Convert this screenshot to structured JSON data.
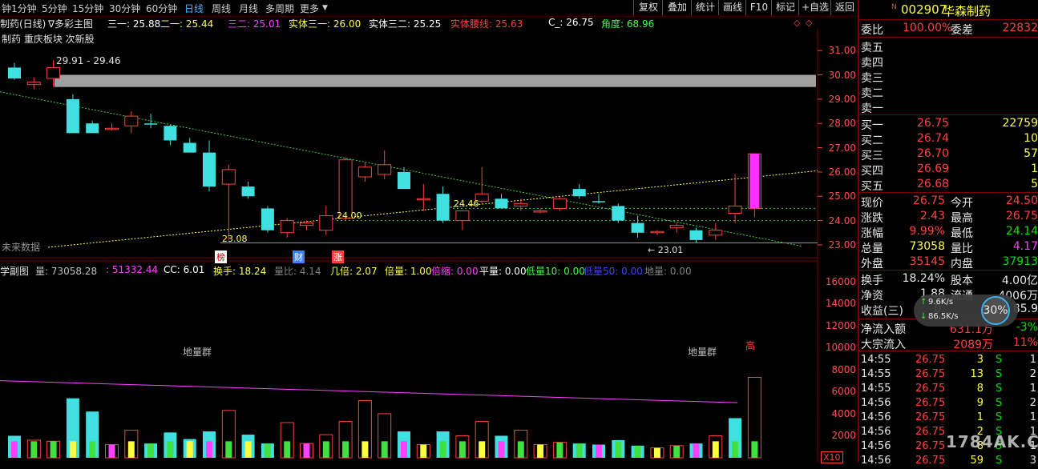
{
  "toolbar": {
    "periods": [
      "1分钟",
      "5分钟",
      "15分钟",
      "30分钟",
      "60分钟",
      "日线",
      "周线",
      "月线",
      "多周期",
      "更多"
    ],
    "active": "日线",
    "buttons": [
      "复权",
      "叠加",
      "统计",
      "画线",
      "F10",
      "标记",
      "+自选",
      "返回"
    ],
    "lead_label": "钟"
  },
  "main": {
    "title": "制药(日线)",
    "title_suffix": "∇多彩主图",
    "indicators": [
      {
        "label": "三一: 25.88",
        "color": "#ffffff"
      },
      {
        "label": "二一: 25.44",
        "color": "#ffff40"
      },
      {
        "label": "三二: 25.01",
        "color": "#ff40ff"
      },
      {
        "label": "实体三一: 26.00",
        "color": "#ffff40"
      },
      {
        "label": "实体三二: 25.25",
        "color": "#ffffff"
      },
      {
        "label": "实体腰线: 25.63",
        "color": "#ff4040"
      },
      {
        "label": "C_: 26.75",
        "color": "#ffffff"
      },
      {
        "label": "角度: 68.96",
        "color": "#40ff40"
      }
    ],
    "sector_label": "制药 重庆板块 次新股",
    "range_label": "29.91 - 29.46",
    "future_label": "未来数据",
    "price_ticks": [
      "31.00",
      "30.00",
      "29.00",
      "28.00",
      "27.00",
      "26.00",
      "25.00",
      "24.00",
      "23.00"
    ],
    "level_labels": {
      "low": "23.08",
      "mid1": "24.00",
      "mid2": "24.46",
      "right_low": "← 23.01"
    },
    "markers": [
      "榜",
      "财",
      "涨"
    ]
  },
  "sub": {
    "title": "学副图",
    "indicators": [
      {
        "label": "量: 73058.28",
        "color": "#c0c0c0"
      },
      {
        "label": ": 51332.44",
        "color": "#ff40ff"
      },
      {
        "label": "CC: 6.01",
        "color": "#ffffff"
      },
      {
        "label": "换手: 18.24",
        "color": "#ffff40"
      },
      {
        "label": "量比: 4.14",
        "color": "#808080"
      },
      {
        "label": "几倍: 2.07",
        "color": "#ffff40"
      },
      {
        "label": "倍量: 1.00",
        "color": "#ffff40"
      },
      {
        "label": "倍缩: 0.00",
        "color": "#ff40ff"
      },
      {
        "label": "平量: 0.00",
        "color": "#ffffff"
      },
      {
        "label": "低量10: 0.00",
        "color": "#40ff40"
      },
      {
        "label": "低量50: 0.00",
        "color": "#4040ff"
      },
      {
        "label": "地量: 0.00",
        "color": "#808080"
      }
    ],
    "vol_ticks": [
      "16000",
      "14000",
      "12000",
      "10000",
      "8000",
      "6000",
      "4000",
      "2000"
    ],
    "notes": {
      "dl1": "地量群",
      "dl2": "地量群",
      "high": "高",
      "unit": "X10"
    }
  },
  "quote": {
    "code": "002907",
    "name": "华森制药",
    "weibi_label": "委比",
    "weibi": "100.00%",
    "weicha_label": "委差",
    "weicha": "22832",
    "sells": [
      "卖五",
      "卖四",
      "卖三",
      "卖二",
      "卖一"
    ],
    "buys": [
      {
        "label": "买一",
        "price": "26.75",
        "vol": "22759"
      },
      {
        "label": "买二",
        "price": "26.74",
        "vol": "10"
      },
      {
        "label": "买三",
        "price": "26.70",
        "vol": "57"
      },
      {
        "label": "买四",
        "price": "26.69",
        "vol": "1"
      },
      {
        "label": "买五",
        "price": "26.68",
        "vol": "5"
      }
    ],
    "stats": [
      {
        "l1": "现价",
        "v1": "26.75",
        "c1": "red",
        "l2": "今开",
        "v2": "24.50",
        "c2": "red"
      },
      {
        "l1": "涨跌",
        "v1": "2.43",
        "c1": "red",
        "l2": "最高",
        "v2": "26.75",
        "c2": "red"
      },
      {
        "l1": "涨幅",
        "v1": "9.99%",
        "c1": "red",
        "l2": "最低",
        "v2": "24.14",
        "c2": "green"
      },
      {
        "l1": "总量",
        "v1": "73058",
        "c1": "yellow",
        "l2": "量比",
        "v2": "4.17",
        "c2": "magenta"
      },
      {
        "l1": "外盘",
        "v1": "35145",
        "c1": "red",
        "l2": "内盘",
        "v2": "37913",
        "c2": "green"
      }
    ],
    "fin": [
      {
        "l1": "换手",
        "v1": "18.24%",
        "l2": "股本",
        "v2": "4.00亿"
      },
      {
        "l1": "净资",
        "v1": "1.88",
        "l2": "流通",
        "v2": "4006万"
      },
      {
        "l1": "收益(三)",
        "v1": "0.",
        "l2": "",
        "v2": "85.9"
      }
    ],
    "flow": [
      {
        "label": "净流入额",
        "v1": "631.1万",
        "v2": "-3%"
      },
      {
        "label": "大宗流入",
        "v1": "2089万",
        "v2": "11%"
      }
    ],
    "ticks": [
      {
        "t": "14:55",
        "p": "26.75",
        "v": "3",
        "s": "S",
        "n": "1"
      },
      {
        "t": "14:55",
        "p": "26.75",
        "v": "13",
        "s": "S",
        "n": "2"
      },
      {
        "t": "14:55",
        "p": "26.75",
        "v": "8",
        "s": "S",
        "n": "1"
      },
      {
        "t": "14:56",
        "p": "26.75",
        "v": "9",
        "s": "S",
        "n": "2"
      },
      {
        "t": "14:56",
        "p": "26.75",
        "v": "1",
        "s": "S",
        "n": "1"
      },
      {
        "t": "14:56",
        "p": "26.75",
        "v": "2",
        "s": "S",
        "n": "1"
      },
      {
        "t": "14:56",
        "p": "26.75",
        "v": "8",
        "s": "S",
        "n": "1"
      },
      {
        "t": "14:56",
        "p": "26.75",
        "v": "59",
        "s": "S",
        "n": "3"
      }
    ],
    "speed": {
      "pct": "30%",
      "up": "9.6K/s",
      "down": "86.5K/s"
    }
  },
  "watermark": "1784AK.COM",
  "colors": {
    "up": "#ff4040",
    "down": "#40e0e0",
    "frame": "#7a0000"
  },
  "chart_data": {
    "type": "candlestick",
    "price_range": [
      22.8,
      31.5
    ],
    "volume_range": [
      0,
      17000
    ],
    "candles": [
      {
        "o": 30.3,
        "h": 30.5,
        "l": 29.8,
        "c": 29.85,
        "dir": "down"
      },
      {
        "o": 29.6,
        "h": 29.9,
        "l": 29.4,
        "c": 29.7,
        "dir": "up"
      },
      {
        "o": 29.85,
        "h": 30.6,
        "l": 29.5,
        "c": 30.3,
        "dir": "up"
      },
      {
        "o": 29.0,
        "h": 29.2,
        "l": 27.6,
        "c": 27.6,
        "dir": "down"
      },
      {
        "o": 28.0,
        "h": 28.1,
        "l": 27.7,
        "c": 27.6,
        "dir": "down"
      },
      {
        "o": 27.8,
        "h": 28.0,
        "l": 27.7,
        "c": 27.8,
        "dir": "up"
      },
      {
        "o": 27.9,
        "h": 28.5,
        "l": 27.6,
        "c": 28.3,
        "dir": "up"
      },
      {
        "o": 28.0,
        "h": 28.4,
        "l": 27.8,
        "c": 27.95,
        "dir": "down"
      },
      {
        "o": 27.9,
        "h": 27.95,
        "l": 27.1,
        "c": 27.3,
        "dir": "down"
      },
      {
        "o": 27.2,
        "h": 27.4,
        "l": 26.8,
        "c": 26.8,
        "dir": "down"
      },
      {
        "o": 26.8,
        "h": 27.3,
        "l": 25.2,
        "c": 25.4,
        "dir": "down"
      },
      {
        "o": 25.5,
        "h": 26.3,
        "l": 23.2,
        "c": 26.1,
        "dir": "up"
      },
      {
        "o": 25.4,
        "h": 25.6,
        "l": 24.9,
        "c": 25.0,
        "dir": "down"
      },
      {
        "o": 24.5,
        "h": 24.6,
        "l": 23.5,
        "c": 23.6,
        "dir": "down"
      },
      {
        "o": 23.5,
        "h": 24.1,
        "l": 23.3,
        "c": 24.0,
        "dir": "up"
      },
      {
        "o": 23.8,
        "h": 24.0,
        "l": 23.6,
        "c": 23.9,
        "dir": "up"
      },
      {
        "o": 23.6,
        "h": 24.6,
        "l": 23.4,
        "c": 24.2,
        "dir": "up"
      },
      {
        "o": 24.1,
        "h": 26.6,
        "l": 24.0,
        "c": 26.5,
        "dir": "up"
      },
      {
        "o": 25.8,
        "h": 26.4,
        "l": 25.6,
        "c": 26.2,
        "dir": "up"
      },
      {
        "o": 26.3,
        "h": 26.9,
        "l": 25.7,
        "c": 25.9,
        "dir": "up"
      },
      {
        "o": 26.0,
        "h": 26.2,
        "l": 25.3,
        "c": 25.3,
        "dir": "down"
      },
      {
        "o": 24.9,
        "h": 25.5,
        "l": 24.4,
        "c": 24.9,
        "dir": "up"
      },
      {
        "o": 25.1,
        "h": 25.4,
        "l": 23.9,
        "c": 24.0,
        "dir": "down"
      },
      {
        "o": 24.0,
        "h": 24.4,
        "l": 23.6,
        "c": 24.4,
        "dir": "up"
      },
      {
        "o": 24.8,
        "h": 26.2,
        "l": 24.7,
        "c": 25.1,
        "dir": "up"
      },
      {
        "o": 24.9,
        "h": 25.1,
        "l": 24.5,
        "c": 24.5,
        "dir": "down"
      },
      {
        "o": 24.7,
        "h": 24.9,
        "l": 24.4,
        "c": 24.6,
        "dir": "up"
      },
      {
        "o": 24.4,
        "h": 24.5,
        "l": 24.3,
        "c": 24.4,
        "dir": "up"
      },
      {
        "o": 24.5,
        "h": 25.0,
        "l": 24.4,
        "c": 24.9,
        "dir": "up"
      },
      {
        "o": 25.3,
        "h": 25.5,
        "l": 24.9,
        "c": 25.0,
        "dir": "down"
      },
      {
        "o": 24.8,
        "h": 25.1,
        "l": 24.7,
        "c": 24.8,
        "dir": "down"
      },
      {
        "o": 24.6,
        "h": 24.7,
        "l": 23.9,
        "c": 24.0,
        "dir": "down"
      },
      {
        "o": 23.9,
        "h": 24.2,
        "l": 23.3,
        "c": 23.5,
        "dir": "down"
      },
      {
        "o": 23.5,
        "h": 23.6,
        "l": 23.4,
        "c": 23.55,
        "dir": "up"
      },
      {
        "o": 23.7,
        "h": 23.9,
        "l": 23.5,
        "c": 23.8,
        "dir": "up"
      },
      {
        "o": 23.6,
        "h": 23.7,
        "l": 23.1,
        "c": 23.2,
        "dir": "down"
      },
      {
        "o": 23.4,
        "h": 23.9,
        "l": 23.2,
        "c": 23.6,
        "dir": "up"
      },
      {
        "o": 24.3,
        "h": 25.9,
        "l": 23.9,
        "c": 24.6,
        "dir": "up"
      },
      {
        "o": 24.5,
        "h": 26.75,
        "l": 24.14,
        "c": 26.75,
        "dir": "up"
      }
    ],
    "volumes": [
      {
        "v": 2000,
        "dir": "down"
      },
      {
        "v": 1600,
        "dir": "up"
      },
      {
        "v": 1500,
        "dir": "up"
      },
      {
        "v": 5400,
        "dir": "down"
      },
      {
        "v": 4200,
        "dir": "down"
      },
      {
        "v": 1200,
        "dir": "up"
      },
      {
        "v": 2500,
        "dir": "up"
      },
      {
        "v": 1300,
        "dir": "down"
      },
      {
        "v": 2300,
        "dir": "down"
      },
      {
        "v": 1700,
        "dir": "down"
      },
      {
        "v": 2400,
        "dir": "down"
      },
      {
        "v": 4300,
        "dir": "up"
      },
      {
        "v": 2100,
        "dir": "down"
      },
      {
        "v": 1300,
        "dir": "down"
      },
      {
        "v": 3200,
        "dir": "up"
      },
      {
        "v": 1300,
        "dir": "up"
      },
      {
        "v": 2100,
        "dir": "up"
      },
      {
        "v": 3300,
        "dir": "up"
      },
      {
        "v": 5200,
        "dir": "up"
      },
      {
        "v": 4000,
        "dir": "up"
      },
      {
        "v": 2400,
        "dir": "down"
      },
      {
        "v": 1200,
        "dir": "up"
      },
      {
        "v": 2400,
        "dir": "down"
      },
      {
        "v": 2000,
        "dir": "up"
      },
      {
        "v": 3300,
        "dir": "up"
      },
      {
        "v": 2000,
        "dir": "down"
      },
      {
        "v": 2500,
        "dir": "up"
      },
      {
        "v": 1200,
        "dir": "up"
      },
      {
        "v": 1400,
        "dir": "up"
      },
      {
        "v": 1300,
        "dir": "down"
      },
      {
        "v": 1200,
        "dir": "down"
      },
      {
        "v": 1600,
        "dir": "down"
      },
      {
        "v": 1100,
        "dir": "down"
      },
      {
        "v": 900,
        "dir": "up"
      },
      {
        "v": 1100,
        "dir": "up"
      },
      {
        "v": 1300,
        "dir": "down"
      },
      {
        "v": 2000,
        "dir": "up"
      },
      {
        "v": 3600,
        "dir": "down"
      },
      {
        "v": 7300,
        "dir": "up"
      }
    ]
  }
}
